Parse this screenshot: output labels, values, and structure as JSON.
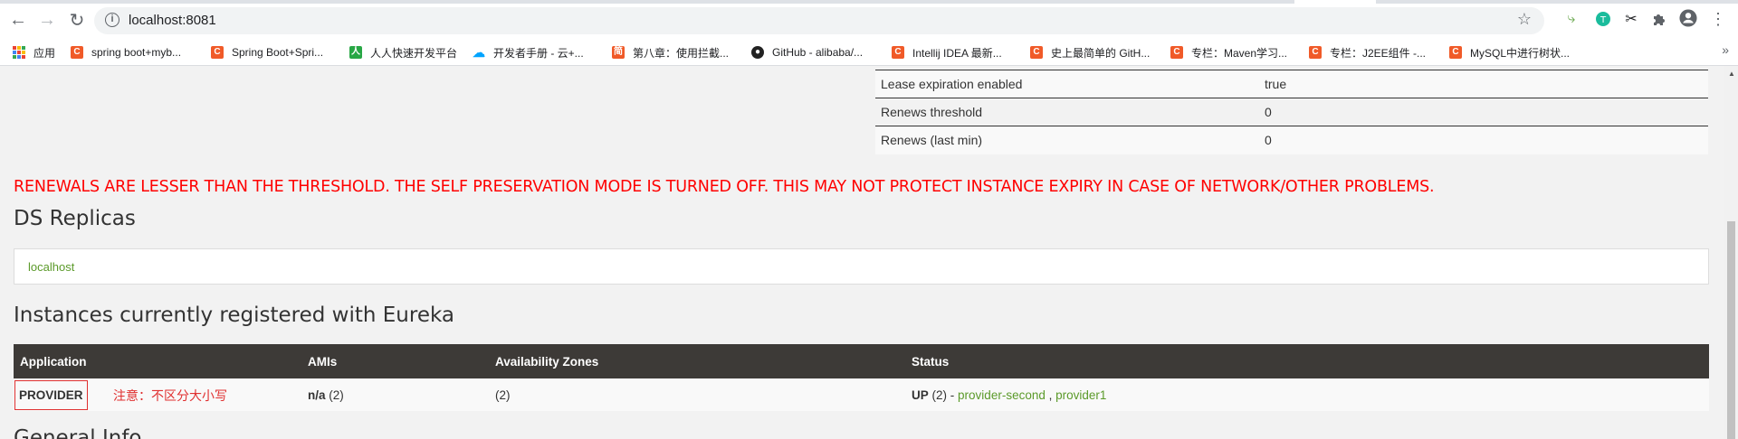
{
  "browser": {
    "url": "localhost:8081",
    "bookmarks": [
      {
        "label": "应用",
        "icon": "apps-grid-icon"
      },
      {
        "label": "spring boot+myb...",
        "icon": "csdn-icon"
      },
      {
        "label": "Spring Boot+Spri...",
        "icon": "csdn-icon"
      },
      {
        "label": "人人快速开发平台",
        "icon": "renren-icon"
      },
      {
        "label": "开发者手册 - 云+...",
        "icon": "cloud-icon"
      },
      {
        "label": "第八章：使用拦截...",
        "icon": "jianshu-icon"
      },
      {
        "label": "GitHub - alibaba/...",
        "icon": "github-icon"
      },
      {
        "label": "Intellij IDEA 最新...",
        "icon": "csdn-icon"
      },
      {
        "label": "史上最简单的 GitH...",
        "icon": "csdn-icon"
      },
      {
        "label": "专栏：Maven学习...",
        "icon": "csdn-icon"
      },
      {
        "label": "专栏：J2EE组件 -...",
        "icon": "csdn-icon"
      },
      {
        "label": "MySQL中进行树状...",
        "icon": "csdn-icon"
      }
    ],
    "more_bookmarks": "»"
  },
  "lease_table": [
    {
      "label": "Lease expiration enabled",
      "value": "true"
    },
    {
      "label": "Renews threshold",
      "value": "0"
    },
    {
      "label": "Renews (last min)",
      "value": "0"
    }
  ],
  "warning": "RENEWALS ARE LESSER THAN THE THRESHOLD. THE SELF PRESERVATION MODE IS TURNED OFF. THIS MAY NOT PROTECT INSTANCE EXPIRY IN CASE OF NETWORK/OTHER PROBLEMS.",
  "ds_replicas": {
    "heading": "DS Replicas",
    "items": [
      "localhost"
    ]
  },
  "instances": {
    "heading": "Instances currently registered with Eureka",
    "columns": [
      "Application",
      "AMIs",
      "Availability Zones",
      "Status"
    ],
    "rows": [
      {
        "application": "PROVIDER",
        "note": "注意：不区分大小写",
        "amis_label": "n/a",
        "amis_count": "(2)",
        "zones": "(2)",
        "status_label": "UP",
        "status_count": "(2) -",
        "instance1": "provider-second",
        "separator": ",",
        "instance2": "provider1"
      }
    ]
  },
  "next_heading": "General Info",
  "colors": {
    "warning": "#ff0000",
    "link_green": "#5b9a2a",
    "table_header_bg": "#3d3a37",
    "annotation_red": "#e03030"
  }
}
